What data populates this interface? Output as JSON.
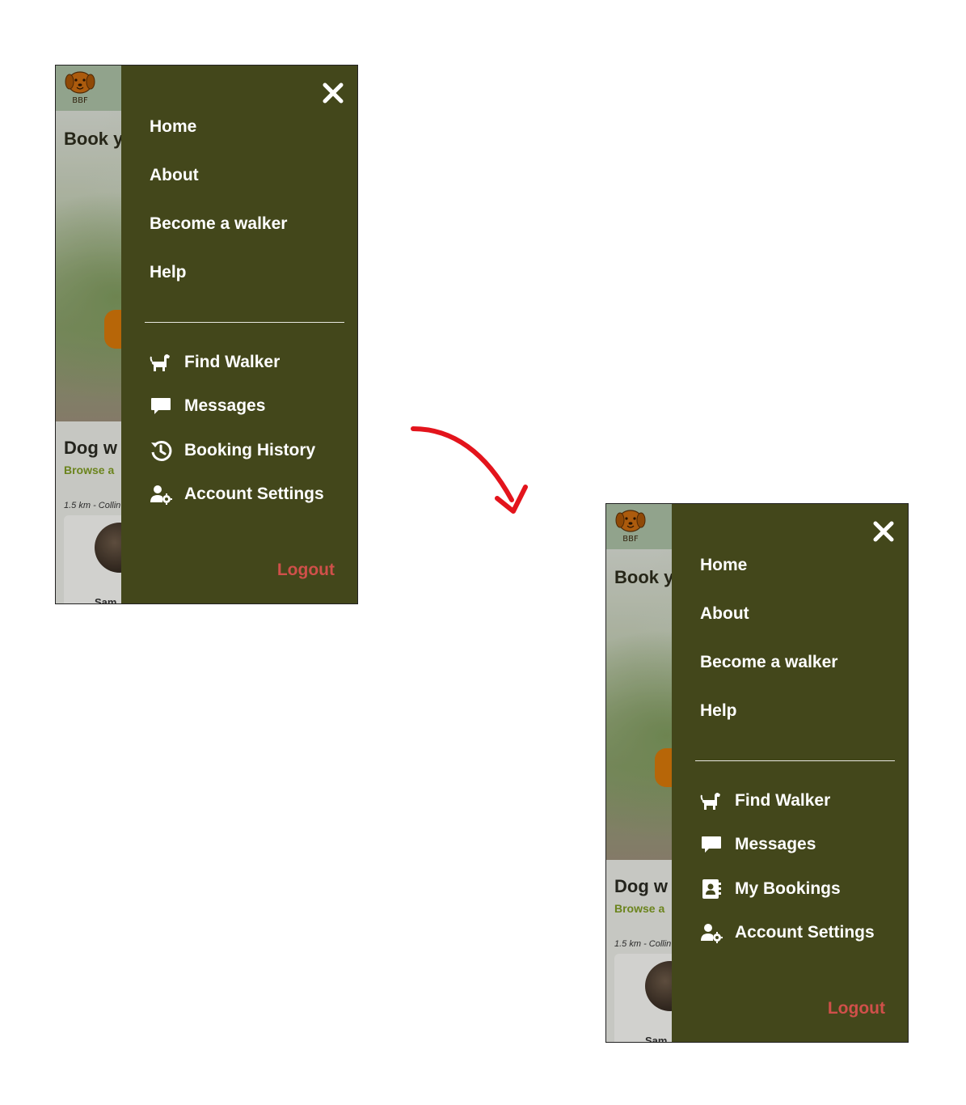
{
  "before": {
    "background": {
      "hero_title": "Book y",
      "section_title": "Dog w",
      "browse_text": "Browse a",
      "distance": "1.5 km - Collin",
      "card_name": "Sam"
    },
    "drawer": {
      "nav": [
        "Home",
        "About",
        "Become a walker",
        "Help"
      ],
      "menu": [
        {
          "label": "Find Walker",
          "icon": "dog-icon"
        },
        {
          "label": "Messages",
          "icon": "message-icon"
        },
        {
          "label": "Booking History",
          "icon": "history-icon"
        },
        {
          "label": "Account Settings",
          "icon": "user-settings-icon"
        }
      ],
      "logout": "Logout"
    }
  },
  "after": {
    "background": {
      "hero_title": "Book y",
      "section_title": "Dog w",
      "browse_text": "Browse a",
      "distance": "1.5 km - Collin",
      "card_name": "Sam"
    },
    "drawer": {
      "nav": [
        "Home",
        "About",
        "Become a walker",
        "Help"
      ],
      "menu": [
        {
          "label": "Find Walker",
          "icon": "dog-icon"
        },
        {
          "label": "Messages",
          "icon": "message-icon"
        },
        {
          "label": "My Bookings",
          "icon": "contact-book-icon"
        },
        {
          "label": "Account Settings",
          "icon": "user-settings-icon"
        }
      ],
      "logout": "Logout"
    }
  },
  "logo_text": "BBF",
  "colors": {
    "drawer": "#43471b",
    "logout": "#d0504a",
    "accent_orange": "#d5770a",
    "arrow": "#e3141c",
    "browse_green": "#7d9a22"
  }
}
